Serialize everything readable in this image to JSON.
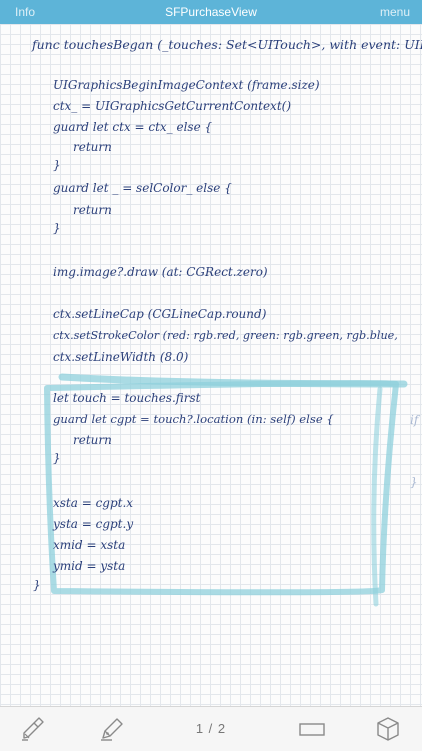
{
  "navbar": {
    "left": "Info",
    "title": "SFPurchaseView",
    "right": "menu"
  },
  "notes": [
    "func   touchesBegan (_touches: Set<UITouch>, with event: UIEvent?",
    "UIGraphicsBeginImageContext (frame.size)",
    "ctx_ = UIGraphicsGetCurrentContext()",
    "guard let ctx = ctx_ else {",
    "return",
    "}",
    "guard let _ = selColor_  else {",
    "return",
    "}",
    "img.image?.draw (at: CGRect.zero)",
    "ctx.setLineCap (CGLineCap.round)",
    "ctx.setStrokeColor (red: rgb.red, green: rgb.green, rgb.blue,",
    "ctx.setLineWidth (8.0)",
    "let touch = touches.first",
    "guard let cgpt = touch?.location (in: self) else {",
    "return",
    "}",
    "xsta = cgpt.x",
    "ysta = cgpt.y",
    "xmid = xsta",
    "ymid = ysta",
    "}",
    "if",
    "}"
  ],
  "toolbar": {
    "page_counter": "1 / 2",
    "icons": [
      "highlighter-icon",
      "pen-icon",
      "rectangle-icon",
      "cube-icon"
    ]
  },
  "colors": {
    "navbar": "#5db4d8",
    "ink": "#2a3f7a",
    "selection": "#8fd0dc"
  }
}
